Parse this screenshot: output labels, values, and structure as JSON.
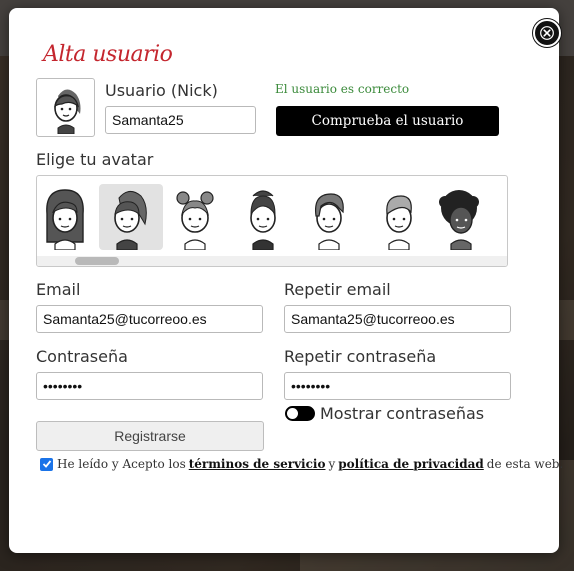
{
  "modal": {
    "title": "Alta usuario",
    "close_icon": "close-icon"
  },
  "nick": {
    "label": "Usuario (Nick)",
    "value": "Samanta25",
    "status": "El usuario es correcto",
    "status_color": "#3a8a3a",
    "check_label": "Comprueba el usuario"
  },
  "avatar": {
    "label": "Elige tu avatar",
    "selected_index": 1,
    "items": [
      "avatar-long-hair",
      "avatar-ponytail",
      "avatar-buns",
      "avatar-updo",
      "avatar-quiff",
      "avatar-short-hair",
      "avatar-curly-afro"
    ]
  },
  "email": {
    "label": "Email",
    "value": "Samanta25@tucorreoo.es",
    "repeat_label": "Repetir email",
    "repeat_value": "Samanta25@tucorreoo.es"
  },
  "password": {
    "label": "Contraseña",
    "value": "••••••••",
    "repeat_label": "Repetir contraseña",
    "repeat_value": "••••••••",
    "show_label": "Mostrar contraseñas"
  },
  "register_label": "Registrarse",
  "terms": {
    "prefix": "He leído y Acepto los",
    "link1": "términos de servicio",
    "mid": "y",
    "link2": "política de privacidad",
    "suffix": "de esta web.",
    "checked": true
  },
  "colors": {
    "title": "#c4262e",
    "primary_button": "#000000",
    "checkbox": "#1a73e8"
  }
}
